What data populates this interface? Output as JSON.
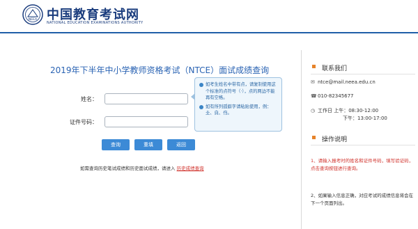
{
  "header": {
    "site_title": "中国教育考试网",
    "site_subtitle": "NATIONAL EDUCATION EXAMINATIONS AUTHORITY",
    "logo_text": "NEEA"
  },
  "main": {
    "title": "2019年下半年中小学教师资格考试（NTCE）面试成绩查询",
    "name_label": "姓名：",
    "id_label": "证件号码：",
    "name_value": "",
    "id_value": "",
    "tips": [
      "如考生姓名中带有点，请复制使用这个标准的点符号（·），点的两边不能再有空格。",
      "如有所列孤僻字请粘贴使用，例：㐀、㒵、㑇。"
    ],
    "buttons": {
      "query": "查询",
      "reset": "重填",
      "back": "返回"
    },
    "history_text": "如需查询历史笔试成绩和历史面试成绩，请进入",
    "history_link": "历史成绩查询"
  },
  "side": {
    "contact_title": "联系我们",
    "email": "ntce@mail.neea.edu.cn",
    "phone": "010-82345677",
    "hours_line1": "工作日 上午：08:30-12:00",
    "hours_line2": "下午：13:00-17:00",
    "help_title": "操作说明",
    "help_1": "1、请输入报考时的姓名和证件号码，填写验证码，点击查询按钮进行查询。",
    "help_2": "2、如果输入信息正确，对应考试的成绩信息将会在下一个页面列出。"
  },
  "colors": {
    "accent": "#2a63b3",
    "button": "#3c8ad6",
    "highlight": "#d0302a",
    "marker": "#e6832a"
  }
}
